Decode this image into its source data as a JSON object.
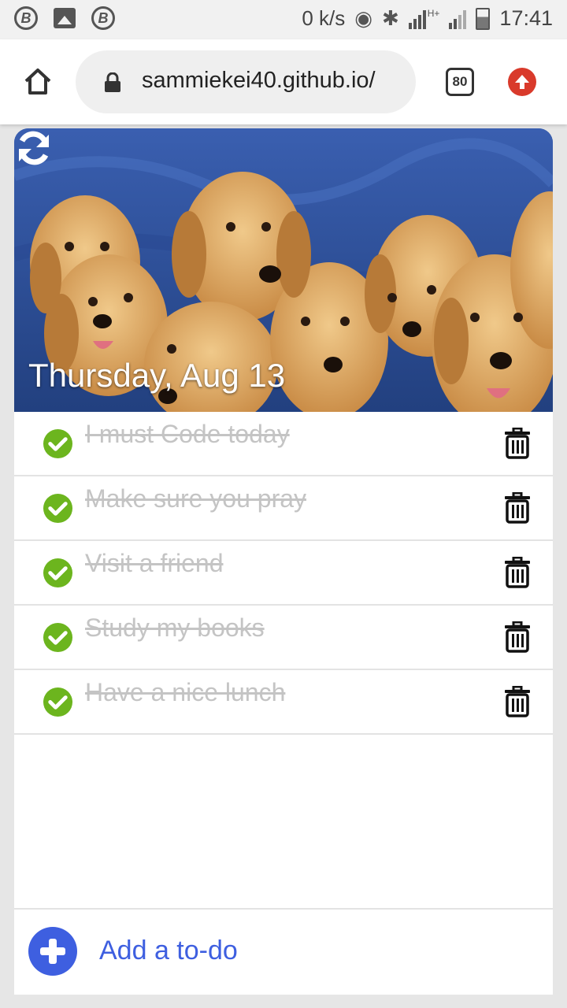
{
  "status_bar": {
    "speed": "0 k/s",
    "network": "H+",
    "time": "17:41"
  },
  "browser": {
    "url": "sammiekei40.github.io/",
    "tab_count": "80"
  },
  "app": {
    "date": "Thursday, Aug 13",
    "todos": [
      {
        "text": "I must Code today",
        "done": true
      },
      {
        "text": "Make sure you pray",
        "done": true
      },
      {
        "text": "Visit a friend",
        "done": true
      },
      {
        "text": "Study my books",
        "done": true
      },
      {
        "text": "Have a nice lunch",
        "done": true
      }
    ],
    "add_label": "Add a to-do"
  },
  "colors": {
    "check": "#6cb51e",
    "accent": "#3e5fe0",
    "update": "#d93a2b",
    "hero_bg": "#2e4f9c"
  }
}
